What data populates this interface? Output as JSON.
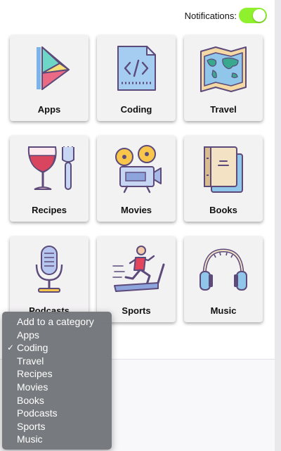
{
  "notifications": {
    "label": "Notifications:",
    "enabled": true
  },
  "colors": {
    "toggle_on": "#8ff02d",
    "card_bg": "#f3f2f3",
    "menu_bg": "#73767a"
  },
  "categories": [
    {
      "label": "Apps",
      "icon": "play-store-icon"
    },
    {
      "label": "Coding",
      "icon": "code-file-icon"
    },
    {
      "label": "Travel",
      "icon": "map-icon"
    },
    {
      "label": "Recipes",
      "icon": "wine-fork-icon"
    },
    {
      "label": "Movies",
      "icon": "film-projector-icon"
    },
    {
      "label": "Books",
      "icon": "book-icon"
    },
    {
      "label": "Podcasts",
      "icon": "microphone-icon"
    },
    {
      "label": "Sports",
      "icon": "treadmill-runner-icon"
    },
    {
      "label": "Music",
      "icon": "headphones-icon"
    }
  ],
  "category_menu": {
    "selected": "Coding",
    "options": [
      "Add to a category",
      "Apps",
      "Coding",
      "Travel",
      "Recipes",
      "Movies",
      "Books",
      "Podcasts",
      "Sports",
      "Music"
    ],
    "check_glyph": "✓"
  }
}
